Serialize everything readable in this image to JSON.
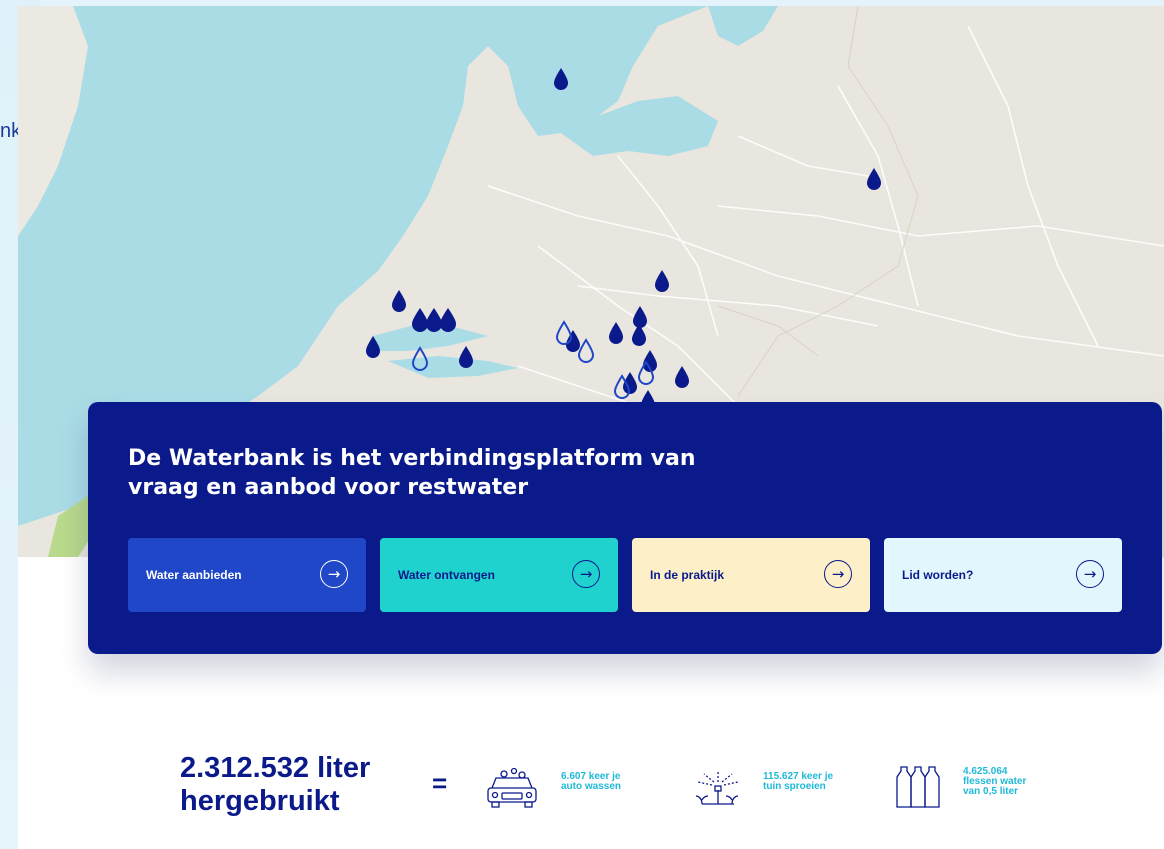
{
  "background": {
    "partial_text": "nk"
  },
  "hero": {
    "title": "De Waterbank is het verbindingsplatform van vraag en aanbod voor restwater",
    "buttons": [
      {
        "label": "Water aanbieden",
        "icon": "arrow-right-icon"
      },
      {
        "label": "Water ontvangen",
        "icon": "arrow-right-icon"
      },
      {
        "label": "In de praktijk",
        "icon": "arrow-right-icon"
      },
      {
        "label": "Lid worden?",
        "icon": "arrow-right-icon"
      }
    ]
  },
  "stats": {
    "total": "2.312.532 liter\nhergebruikt",
    "equals": "=",
    "items": [
      {
        "icon": "car-wash-icon",
        "text": "6.607 keer je\nauto wassen"
      },
      {
        "icon": "sprinkler-icon",
        "text": "115.627 keer je\ntuin sproeien"
      },
      {
        "icon": "bottles-icon",
        "text": "4.625.064\nflessen water\nvan 0,5 liter"
      }
    ]
  },
  "colors": {
    "navy": "#0b1a8a",
    "blue": "#1f47c8",
    "turquoise": "#1fd2cd",
    "cream": "#fdefc8",
    "light_blue": "#e2f6fd",
    "stat_text": "#1fb9d8",
    "sea": "#aadce6"
  }
}
